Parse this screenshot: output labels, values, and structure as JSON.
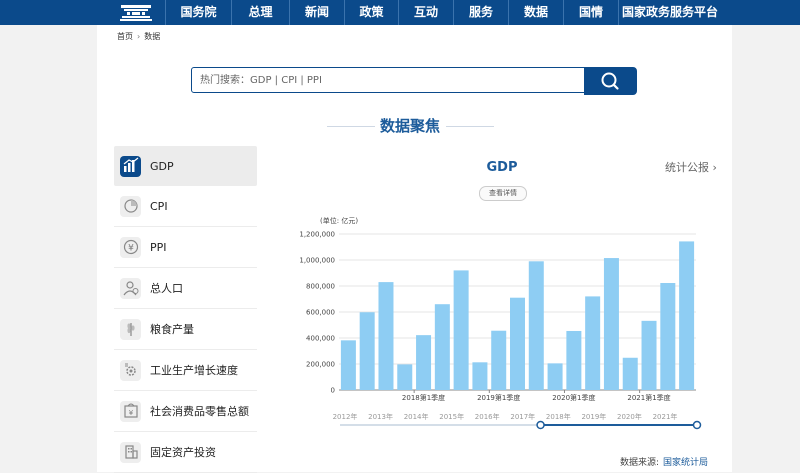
{
  "nav": {
    "items": [
      "国务院",
      "总理",
      "新闻",
      "政策",
      "互动",
      "服务",
      "数据",
      "国情",
      "国家政务服务平台"
    ]
  },
  "breadcrumb": {
    "home": "首页",
    "separator": "›",
    "current": "数据"
  },
  "search": {
    "placeholder": "热门搜索：GDP  |  CPI  |  PPI"
  },
  "section_title": "数据聚焦",
  "sidebar": {
    "items": [
      {
        "label": "GDP",
        "icon": "bar-chart-icon",
        "active": true
      },
      {
        "label": "CPI",
        "icon": "pie-chart-icon",
        "active": false
      },
      {
        "label": "PPI",
        "icon": "yuan-coin-icon",
        "active": false
      },
      {
        "label": "总人口",
        "icon": "person-icon",
        "active": false
      },
      {
        "label": "粮食产量",
        "icon": "wheat-icon",
        "active": false
      },
      {
        "label": "工业生产增长速度",
        "icon": "factory-gear-icon",
        "active": false
      },
      {
        "label": "社会消费品零售总额",
        "icon": "shopping-icon",
        "active": false
      },
      {
        "label": "固定资产投资",
        "icon": "building-icon",
        "active": false
      }
    ]
  },
  "chart_header": {
    "title": "GDP",
    "detail_label": "查看详情",
    "report_link": "统计公报"
  },
  "chart_data": {
    "type": "bar",
    "unit_label": "(单位: 亿元)",
    "yticks": [
      "0",
      "200,000",
      "400,000",
      "600,000",
      "800,000",
      "1,000,000",
      "1,200,000"
    ],
    "ylim": [
      0,
      1200000
    ],
    "values": [
      382000,
      598000,
      830000,
      197000,
      422000,
      660000,
      920000,
      213000,
      456000,
      710000,
      990000,
      205000,
      454000,
      720000,
      1015000,
      248000,
      532000,
      823000,
      1143000
    ],
    "category_labels": [
      {
        "index": 4,
        "label": "2018第1季度"
      },
      {
        "index": 8,
        "label": "2019第1季度"
      },
      {
        "index": 12,
        "label": "2020第1季度"
      },
      {
        "index": 16,
        "label": "2021第1季度"
      }
    ],
    "bar_color": "#8ecdf3",
    "timeline_years": [
      "2012年",
      "2013年",
      "2014年",
      "2015年",
      "2016年",
      "2017年",
      "2018年",
      "2019年",
      "2020年",
      "2021年"
    ],
    "timeline_range": [
      "2017年",
      "2021年"
    ]
  },
  "source": {
    "label": "数据来源:",
    "org": "国家统计局"
  },
  "colors": {
    "brand": "#0b4a8b",
    "accent": "#1d5c9b"
  }
}
